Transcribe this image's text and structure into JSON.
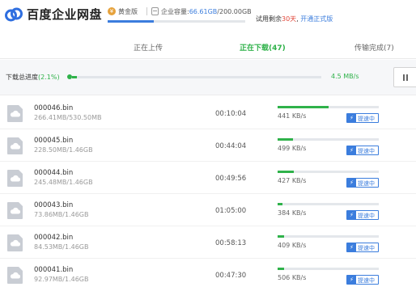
{
  "header": {
    "brand": "百度企业网盘",
    "edition_label": "黄金版",
    "capacity_label": "企业容量:",
    "capacity_used": "66.61GB",
    "capacity_total": "/200.00GB",
    "capacity_fraction": 0.333,
    "trial_prefix": "试用剩余",
    "trial_days": "30天",
    "trial_sep": ", ",
    "trial_link": "开通正式版"
  },
  "tabs": [
    {
      "label": "正在上传",
      "active": false
    },
    {
      "label": "正在下载(47)",
      "active": true
    },
    {
      "label": "传输完成(7)",
      "active": false
    }
  ],
  "total": {
    "label": "下载总进度",
    "pct": "(2.1%)",
    "fraction": 0.021,
    "speed": "4.5 MB/s"
  },
  "downloads": [
    {
      "name": "000046.bin",
      "size": "266.41MB/530.50MB",
      "time": "00:10:04",
      "progress": 0.5,
      "speed": "441 KB/s",
      "boost": "提速中"
    },
    {
      "name": "000045.bin",
      "size": "228.50MB/1.46GB",
      "time": "00:44:04",
      "progress": 0.15,
      "speed": "499 KB/s",
      "boost": "提速中"
    },
    {
      "name": "000044.bin",
      "size": "245.48MB/1.46GB",
      "time": "00:49:56",
      "progress": 0.16,
      "speed": "427 KB/s",
      "boost": "提速中"
    },
    {
      "name": "000043.bin",
      "size": "73.86MB/1.46GB",
      "time": "01:05:00",
      "progress": 0.05,
      "speed": "384 KB/s",
      "boost": "提速中"
    },
    {
      "name": "000042.bin",
      "size": "84.53MB/1.46GB",
      "time": "00:58:13",
      "progress": 0.06,
      "speed": "409 KB/s",
      "boost": "提速中"
    },
    {
      "name": "000041.bin",
      "size": "92.97MB/1.46GB",
      "time": "00:47:30",
      "progress": 0.06,
      "speed": "506 KB/s",
      "boost": "提速中"
    }
  ],
  "colors": {
    "accent_green": "#2fb24a",
    "accent_blue": "#3b7ddd",
    "trial_red": "#e0473a",
    "gold": "#e6a23c"
  },
  "icons": [
    "cloud-logo-icon",
    "gold-badge-icon",
    "capacity-icon",
    "pause-icon",
    "file-cloud-icon",
    "lightning-icon"
  ]
}
